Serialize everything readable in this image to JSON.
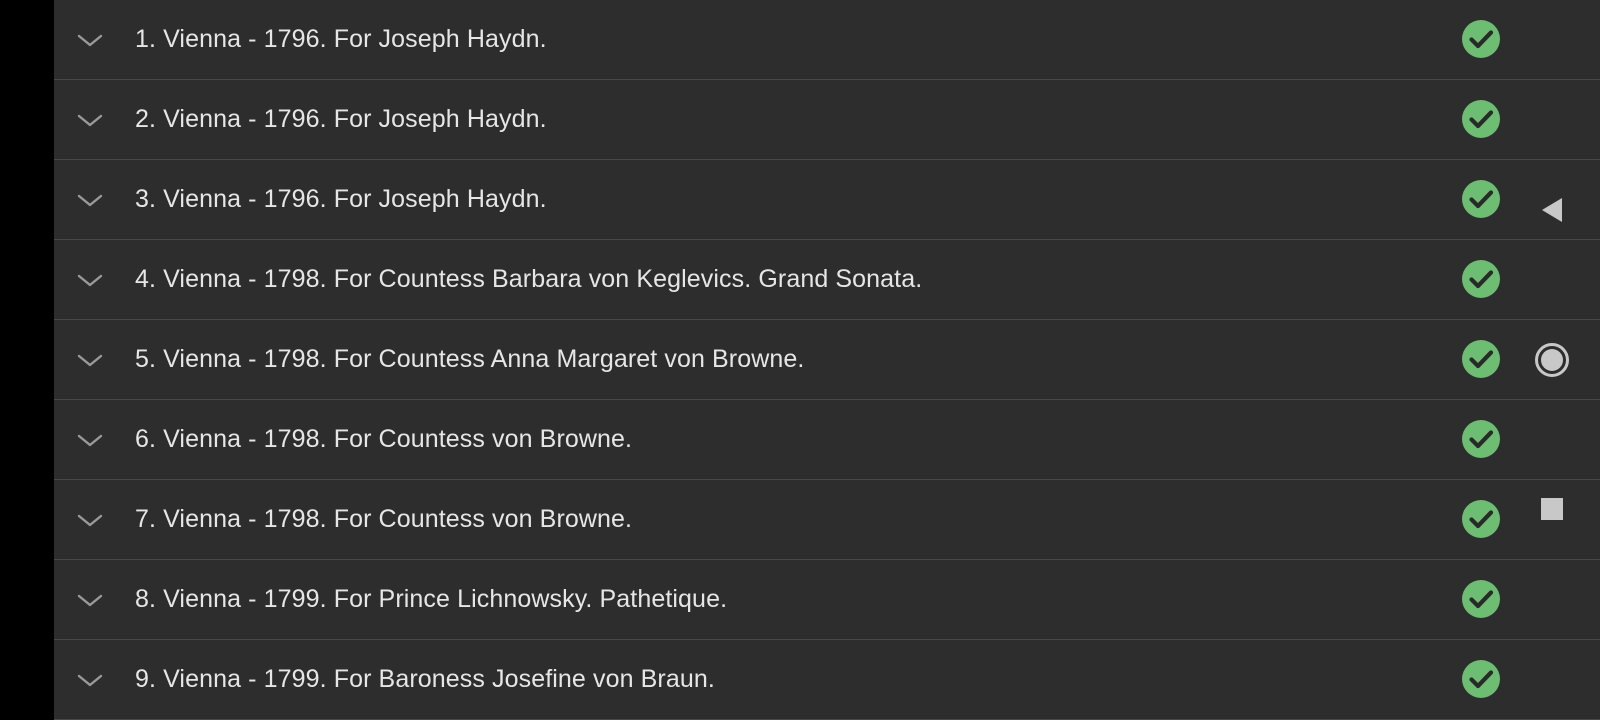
{
  "items": [
    {
      "title": "1. Vienna - 1796. For Joseph Haydn.",
      "expand_icon": "chevron-down-icon",
      "status_icon": "check-circle-icon"
    },
    {
      "title": "2. Vienna - 1796. For Joseph Haydn.",
      "expand_icon": "chevron-down-icon",
      "status_icon": "check-circle-icon"
    },
    {
      "title": "3. Vienna - 1796. For Joseph Haydn.",
      "expand_icon": "chevron-down-icon",
      "status_icon": "check-circle-icon"
    },
    {
      "title": "4. Vienna - 1798. For Countess Barbara von Keglevics. Grand Sonata.",
      "expand_icon": "chevron-down-icon",
      "status_icon": "check-circle-icon"
    },
    {
      "title": "5. Vienna - 1798. For Countess Anna Margaret von Browne.",
      "expand_icon": "chevron-down-icon",
      "status_icon": "check-circle-icon"
    },
    {
      "title": "6. Vienna - 1798. For Countess von Browne.",
      "expand_icon": "chevron-down-icon",
      "status_icon": "check-circle-icon"
    },
    {
      "title": "7. Vienna - 1798. For Countess von Browne.",
      "expand_icon": "chevron-down-icon",
      "status_icon": "check-circle-icon"
    },
    {
      "title": "8. Vienna - 1799. For Prince Lichnowsky. Pathetique.",
      "expand_icon": "chevron-down-icon",
      "status_icon": "check-circle-icon"
    },
    {
      "title": "9. Vienna - 1799. For Baroness Josefine von Braun.",
      "expand_icon": "chevron-down-icon",
      "status_icon": "check-circle-icon"
    }
  ],
  "nav_bar": {
    "back_icon": "back-triangle-icon",
    "home_icon": "home-circle-icon",
    "recents_icon": "recents-square-icon"
  },
  "colors": {
    "background": "#2d2d2d",
    "divider": "#474747",
    "text": "#e6e6e6",
    "check_green": "#6dbd72",
    "nav_icon": "#c8c8c8"
  }
}
